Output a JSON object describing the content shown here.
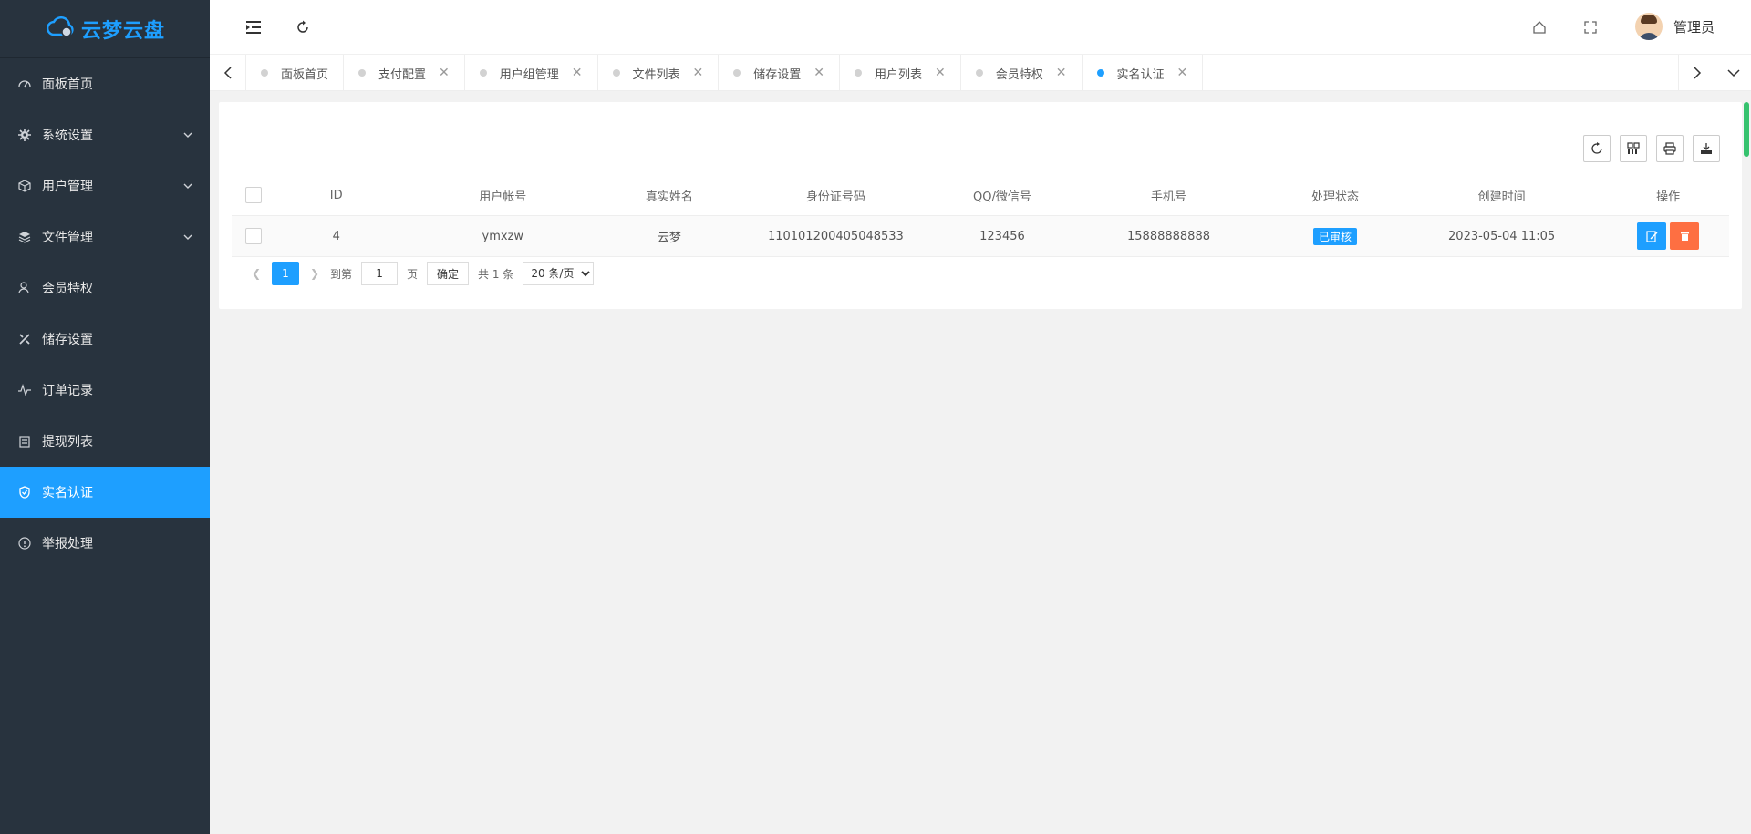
{
  "app": {
    "logo_text": "云梦云盘"
  },
  "sidebar": {
    "items": [
      {
        "label": "面板首页",
        "icon": "dashboard-icon",
        "has_children": false
      },
      {
        "label": "系统设置",
        "icon": "gear-icon",
        "has_children": true
      },
      {
        "label": "用户管理",
        "icon": "cube-icon",
        "has_children": true
      },
      {
        "label": "文件管理",
        "icon": "layers-icon",
        "has_children": true
      },
      {
        "label": "会员特权",
        "icon": "user-icon",
        "has_children": false
      },
      {
        "label": "储存设置",
        "icon": "tools-icon",
        "has_children": false
      },
      {
        "label": "订单记录",
        "icon": "pulse-icon",
        "has_children": false
      },
      {
        "label": "提现列表",
        "icon": "clipboard-icon",
        "has_children": false
      },
      {
        "label": "实名认证",
        "icon": "shield-check-icon",
        "has_children": false,
        "active": true
      },
      {
        "label": "举报处理",
        "icon": "info-icon",
        "has_children": false
      }
    ]
  },
  "header": {
    "user_name": "管理员"
  },
  "tabs": [
    {
      "label": "面板首页",
      "closable": false
    },
    {
      "label": "支付配置",
      "closable": true
    },
    {
      "label": "用户组管理",
      "closable": true
    },
    {
      "label": "文件列表",
      "closable": true
    },
    {
      "label": "储存设置",
      "closable": true
    },
    {
      "label": "用户列表",
      "closable": true
    },
    {
      "label": "会员特权",
      "closable": true
    },
    {
      "label": "实名认证",
      "closable": true,
      "active": true
    }
  ],
  "table": {
    "columns": [
      "ID",
      "用户帐号",
      "真实姓名",
      "身份证号码",
      "QQ/微信号",
      "手机号",
      "处理状态",
      "创建时间",
      "操作"
    ],
    "rows": [
      {
        "id": "4",
        "account": "ymxzw",
        "real_name": "云梦",
        "id_card": "110101200405048533",
        "qq_wechat": "123456",
        "phone": "15888888888",
        "status": "已审核",
        "created": "2023-05-04 11:05"
      }
    ]
  },
  "pager": {
    "current": "1",
    "goto_label": "到第",
    "goto_value": "1",
    "page_unit": "页",
    "confirm": "确定",
    "total": "共 1 条",
    "page_size": "20 条/页"
  },
  "colors": {
    "accent": "#1e9fff",
    "sidebar_bg": "#28333e",
    "danger": "#ff5722"
  }
}
